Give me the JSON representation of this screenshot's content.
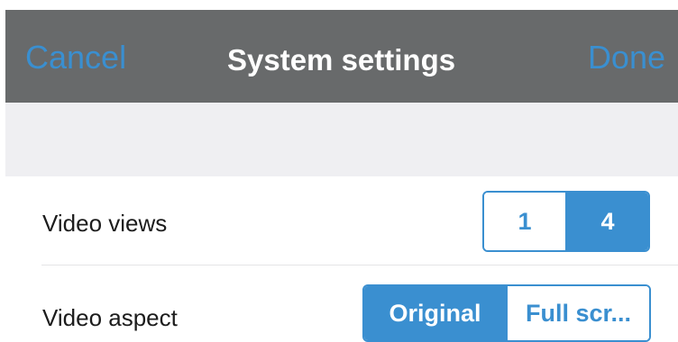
{
  "navbar": {
    "left_label": "Cancel",
    "title": "System settings",
    "right_label": "Done"
  },
  "settings": {
    "video_views": {
      "label": "Video views",
      "options": [
        "1",
        "4"
      ],
      "selected": "4"
    },
    "video_aspect": {
      "label": "Video aspect",
      "options": [
        "Original",
        "Full scr..."
      ],
      "selected": "Original"
    }
  },
  "colors": {
    "navbar_background": "#686a6b",
    "accent": "#3a8fd0",
    "section_background": "#efeff2"
  }
}
